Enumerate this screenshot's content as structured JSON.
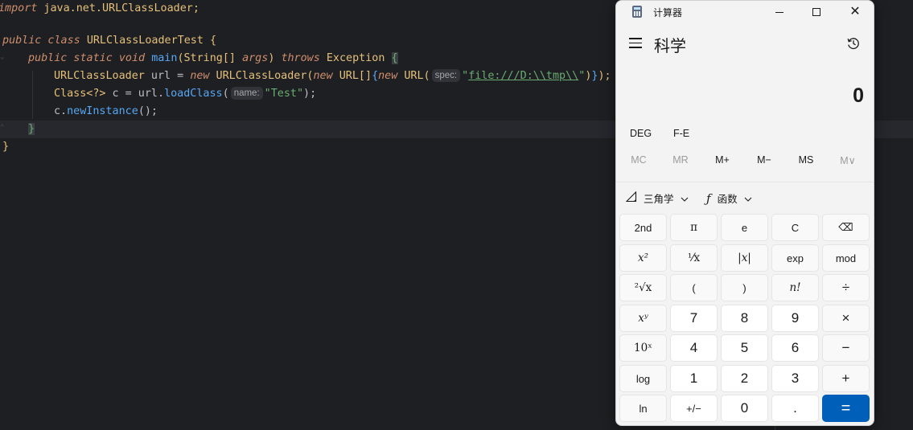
{
  "editor": {
    "line1": {
      "kw": "import",
      "pkg": " java.net.URLClassLoader;"
    },
    "line3": {
      "mods": "public class",
      "cls": "URLClassLoaderTest",
      "brace": "{"
    },
    "line4": {
      "mods": "public static void",
      "fn": "main",
      "args_open": "(String[] ",
      "args_param": "args",
      "args_close": ") ",
      "throws": "throws",
      "exc": "Exception",
      "brace": "{"
    },
    "line5": {
      "type": "URLClassLoader",
      "var": " url = ",
      "new1": "new",
      "ctor": " URLClassLoader(",
      "new2": "new",
      "arr": " URL[]",
      "brace_open": "{",
      "new3": "new",
      "url": " URL(",
      "hint": "spec:",
      "q1": "\"",
      "path": "file:///D:\\\\tmp\\\\",
      "q2": "\"",
      "close_paren": ")",
      "brace_close": "}",
      "end": ");"
    },
    "line6": {
      "type": "Class<?>",
      "var": " c = url.",
      "fn": "loadClass",
      "open": "(",
      "hint": "name:",
      "str": "\"Test\"",
      "end": ");"
    },
    "line7": {
      "obj": "c.",
      "fn": "newInstance",
      "end": "();"
    },
    "line8": {
      "brace": "}"
    },
    "line9": {
      "brace": "}"
    }
  },
  "calculator": {
    "app_title": "计算器",
    "mode": "科学",
    "display_value": "0",
    "angle_unit": "DEG",
    "fe": "F-E",
    "memory": [
      "MC",
      "MR",
      "M+",
      "M−",
      "MS",
      "M∨"
    ],
    "trig_label": "三角学",
    "func_label": "函数",
    "keys": {
      "r1": [
        "2nd",
        "π",
        "e",
        "C",
        "⌫"
      ],
      "r2": [
        "x²",
        "¹⁄x",
        "|x|",
        "exp",
        "mod"
      ],
      "r3": [
        "²√x",
        "(",
        ")",
        "n!",
        "÷"
      ],
      "r4": [
        "xʸ",
        "7",
        "8",
        "9",
        "×"
      ],
      "r5": [
        "10ˣ",
        "4",
        "5",
        "6",
        "−"
      ],
      "r6": [
        "log",
        "1",
        "2",
        "3",
        "+"
      ],
      "r7": [
        "ln",
        "+/−",
        "0",
        ".",
        "="
      ]
    },
    "accent_color": "#005fb8"
  }
}
